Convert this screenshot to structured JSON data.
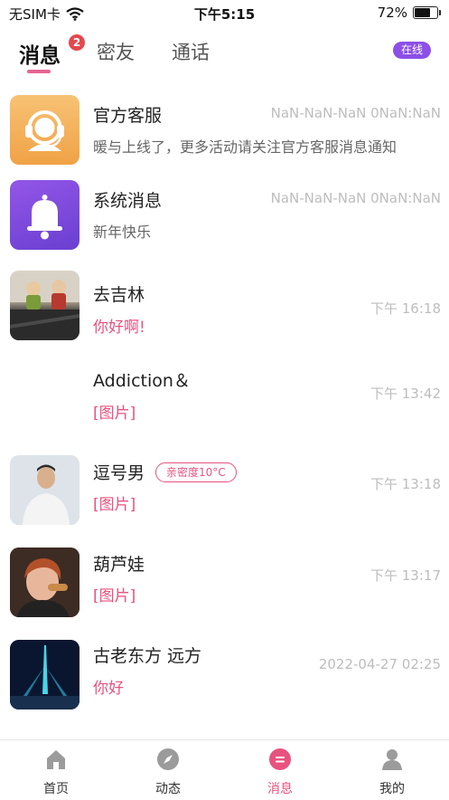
{
  "status_bar": {
    "carrier": "无SIM卡",
    "time": "下午5:15",
    "battery": "72%",
    "battery_level": 0.72
  },
  "header": {
    "tabs": [
      {
        "label": "消息",
        "badge": "2",
        "active": true
      },
      {
        "label": "密友",
        "active": false
      },
      {
        "label": "通话",
        "active": false
      }
    ],
    "online_label": "在线",
    "accent_color": "#e66591",
    "online_color": "#8c4fe7"
  },
  "conversations": [
    {
      "name": "官方客服",
      "message": "暖与上线了，更多活动请关注官方客服消息通知",
      "time": "NaN-NaN-NaN 0NaN:NaN",
      "avatar_icon": "headset-icon"
    },
    {
      "name": "系统消息",
      "message": "新年快乐",
      "time": "NaN-NaN-NaN 0NaN:NaN",
      "avatar_icon": "bell-icon"
    },
    {
      "name": "去吉林",
      "message": "你好啊!",
      "time": "下午 16:18"
    },
    {
      "name": "Addiction＆",
      "message": "[图片]",
      "time": "下午 13:42"
    },
    {
      "name": "逗号男",
      "tag": "亲密度10°C",
      "message": "[图片]",
      "time": "下午 13:18"
    },
    {
      "name": "葫芦娃",
      "message": "[图片]",
      "time": "下午 13:17"
    },
    {
      "name": "古老东方 远方",
      "message": "你好",
      "time": "2022-04-27 02:25"
    }
  ],
  "tab_bar": {
    "items": [
      {
        "label": "首页",
        "icon": "home-icon"
      },
      {
        "label": "动态",
        "icon": "compass-icon"
      },
      {
        "label": "消息",
        "icon": "message-icon",
        "active": true
      },
      {
        "label": "我的",
        "icon": "profile-icon"
      }
    ]
  }
}
